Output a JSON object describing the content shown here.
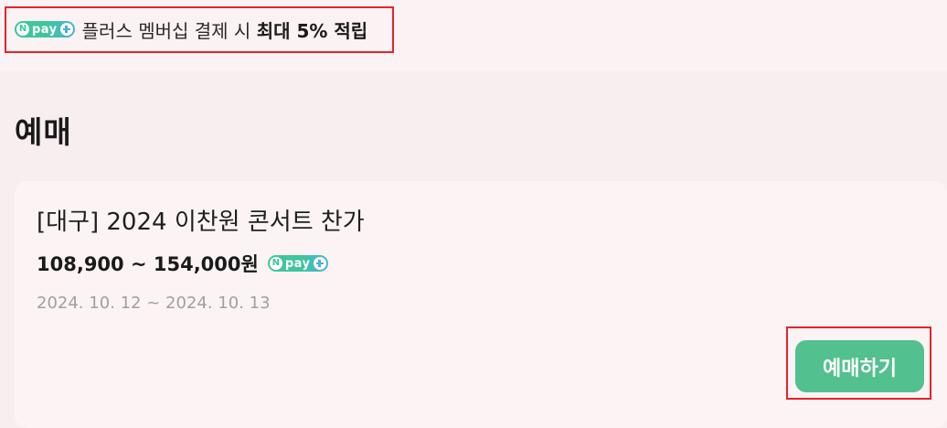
{
  "promo": {
    "badge_n": "N",
    "badge_pay": "pay",
    "text_regular": "플러스 멤버십 결제 시",
    "text_bold": "최대 5% 적립"
  },
  "section": {
    "title": "예매"
  },
  "event_card": {
    "title": "[대구] 2024 이찬원 콘서트 찬가",
    "price": "108,900 ~ 154,000원",
    "badge_n": "N",
    "badge_pay": "pay",
    "dates": "2024. 10. 12 ~ 2024. 10. 13",
    "book_button_label": "예매하기"
  },
  "colors": {
    "background": "#f7eeef",
    "button": "#52c08f",
    "highlight_border": "#e5232c",
    "npay_green": "#3fc69a",
    "npay_blue": "#4ab0e0"
  }
}
